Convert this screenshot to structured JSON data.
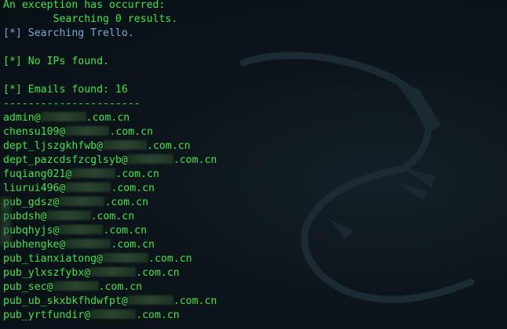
{
  "terminal": {
    "lines": [
      "An exception has occurred:",
      "        Searching 0 results.",
      "[*] Searching Trello.",
      "",
      "[*] No IPs found.",
      "",
      "[*] Emails found: 16",
      "----------------------"
    ],
    "emails": [
      {
        "prefix": "admin@",
        "suffix": ".com.cn"
      },
      {
        "prefix": "chensu109@",
        "suffix": ".com.cn"
      },
      {
        "prefix": "dept_ljszgkhfwb@",
        "suffix": ".com.cn"
      },
      {
        "prefix": "dept_pazcdsfzcglsyb@",
        "suffix": ".com.cn"
      },
      {
        "prefix": "fuqiang021@",
        "suffix": ".com.cn"
      },
      {
        "prefix": "liurui496@",
        "suffix": ".com.cn"
      },
      {
        "prefix": "pub_gdsz@",
        "suffix": ".com.cn"
      },
      {
        "prefix": "pubdsh@",
        "suffix": ".com.cn"
      },
      {
        "prefix": "pubqhyjs@",
        "suffix": ".com.cn"
      },
      {
        "prefix": "pubhengke@",
        "suffix": ".com.cn"
      },
      {
        "prefix": "pub_tianxiatong@",
        "suffix": ".com.cn"
      },
      {
        "prefix": "pub_ylxszfybx@",
        "suffix": ".com.cn"
      },
      {
        "prefix": "pub_sec@",
        "suffix": ".com.cn"
      },
      {
        "prefix": "pub_ub_skxbkfhdwfpt@",
        "suffix": ".com.cn"
      },
      {
        "prefix": "pub_yrtfundir@",
        "suffix": ".com.cn"
      }
    ]
  },
  "colors": {
    "text_green": "#3ee44a",
    "text_blue": "#7aa8d8",
    "background": "#0b1216"
  },
  "icons": {
    "background_logo": "kali-dragon-icon"
  }
}
